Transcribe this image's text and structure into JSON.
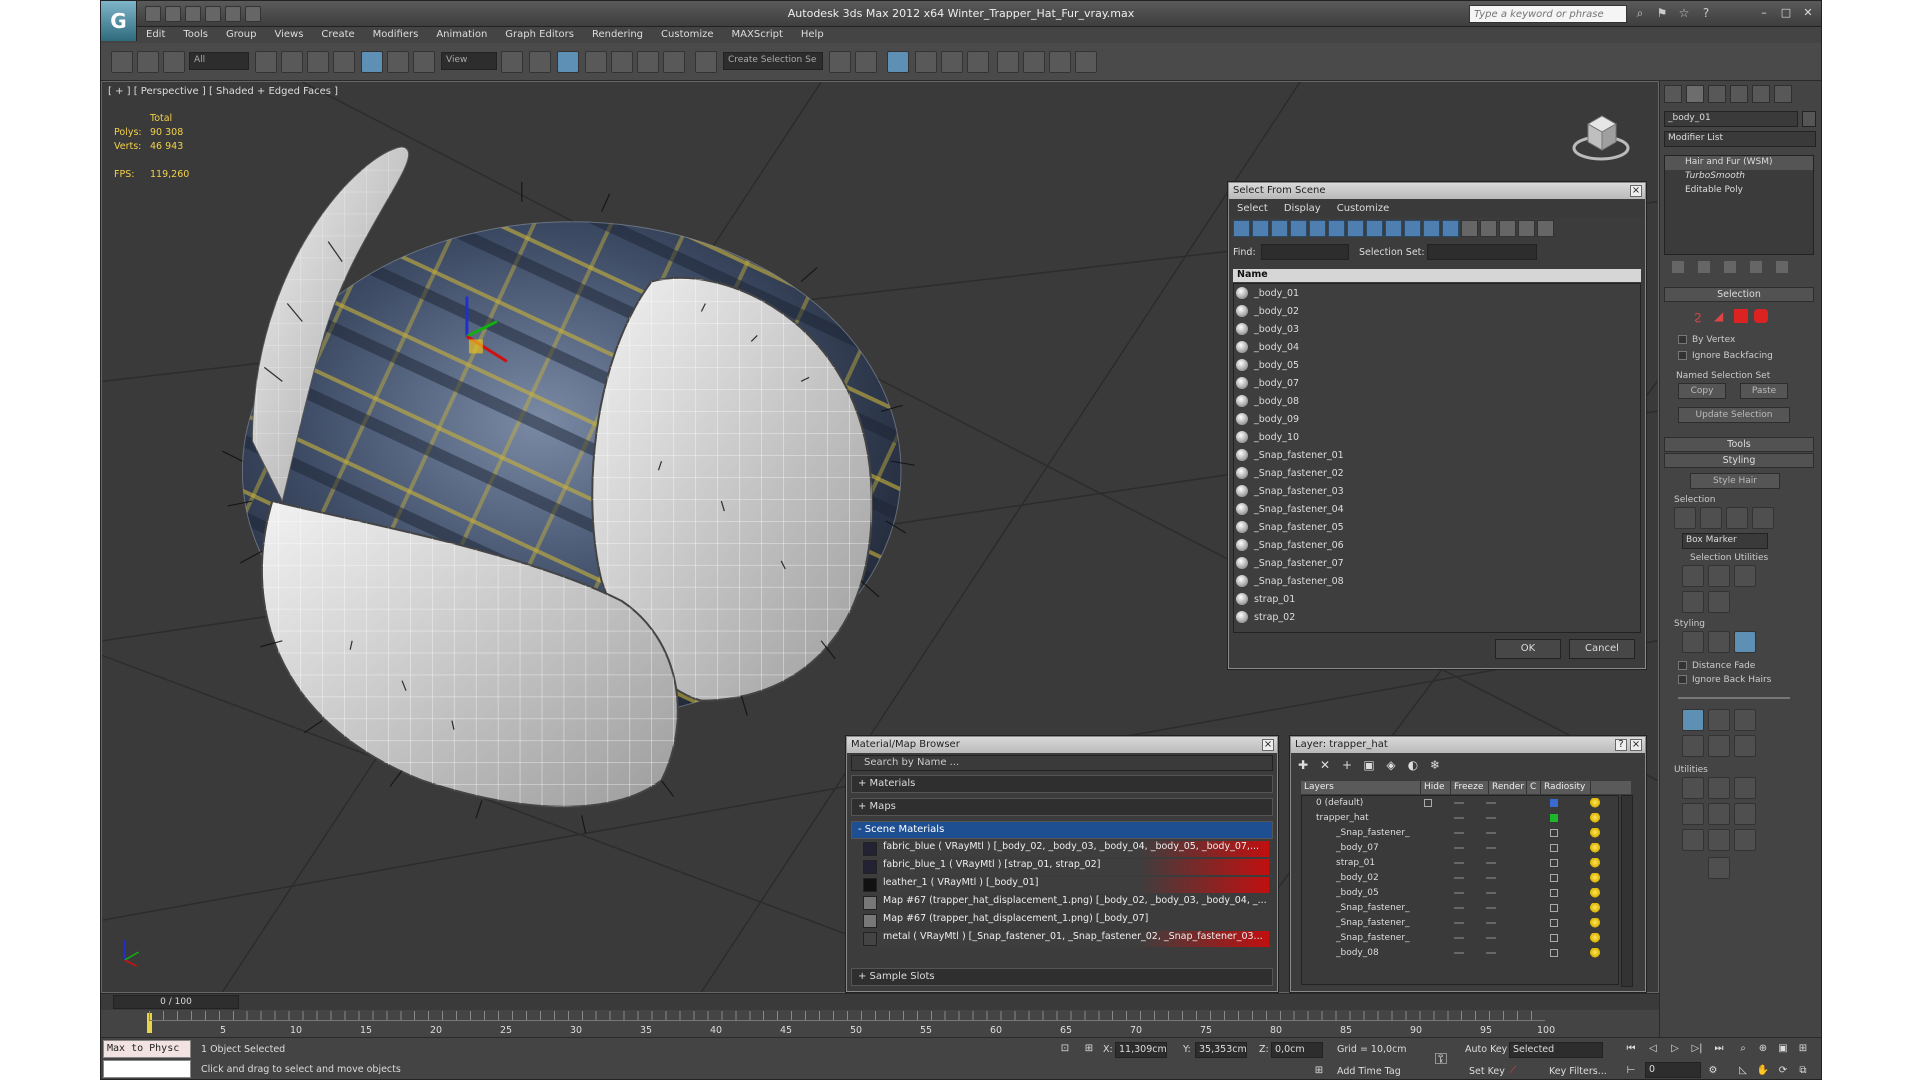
{
  "app": {
    "title": "Autodesk 3ds Max  2012 x64     Winter_Trapper_Hat_Fur_vray.max",
    "logo_glyph": "G",
    "search_placeholder": "Type a keyword or phrase",
    "menu": [
      "Edit",
      "Tools",
      "Group",
      "Views",
      "Create",
      "Modifiers",
      "Animation",
      "Graph Editors",
      "Rendering",
      "Customize",
      "MAXScript",
      "Help"
    ]
  },
  "toolbar": {
    "filter_value": "All",
    "refcoord_value": "View",
    "selection_set_placeholder": "Create Selection Se"
  },
  "viewport": {
    "label": "[ + ] [ Perspective ] [ Shaded + Edged Faces ]",
    "stats_header": "Total",
    "polys_label": "Polys:",
    "polys_value": "90 308",
    "verts_label": "Verts:",
    "verts_value": "46 943",
    "fps_label": "FPS:",
    "fps_value": "119,260"
  },
  "select_from_scene": {
    "title": "Select From Scene",
    "menu": [
      "Select",
      "Display",
      "Customize"
    ],
    "find_label": "Find:",
    "selection_set_label": "Selection Set:",
    "column_name": "Name",
    "items": [
      "_body_01",
      "_body_02",
      "_body_03",
      "_body_04",
      "_body_05",
      "_body_07",
      "_body_08",
      "_body_09",
      "_body_10",
      "_Snap_fastener_01",
      "_Snap_fastener_02",
      "_Snap_fastener_03",
      "_Snap_fastener_04",
      "_Snap_fastener_05",
      "_Snap_fastener_06",
      "_Snap_fastener_07",
      "_Snap_fastener_08",
      "strap_01",
      "strap_02"
    ],
    "ok_label": "OK",
    "cancel_label": "Cancel"
  },
  "material_browser": {
    "title": "Material/Map Browser",
    "search_placeholder": "Search by Name ...",
    "sec_materials": "+ Materials",
    "sec_maps": "+ Maps",
    "sec_scene": "- Scene Materials",
    "sec_sample": "+ Sample Slots",
    "materials": [
      "fabric_blue  ( VRayMtl )  [_body_02, _body_03, _body_04, _body_05, _body_07,...",
      "fabric_blue_1  ( VRayMtl )  [strap_01, strap_02]",
      "leather_1  ( VRayMtl )  [_body_01]",
      "Map #67 (trapper_hat_displacement_1.png) [_body_02, _body_03, _body_04, _...",
      "Map #67 (trapper_hat_displacement_1.png) [_body_07]",
      "metal  ( VRayMtl )  [_Snap_fastener_01, _Snap_fastener_02, _Snap_fastener_03..."
    ]
  },
  "layer_manager": {
    "title": "Layer: trapper_hat",
    "columns": [
      "Layers",
      "Hide",
      "Freeze",
      "Render",
      "C",
      "Radiosity"
    ],
    "rows": [
      "0 (default)",
      "trapper_hat",
      "_Snap_fastener_",
      "_body_07",
      "strap_01",
      "_body_02",
      "_body_05",
      "_Snap_fastener_",
      "_Snap_fastener_",
      "_Snap_fastener_",
      "_body_08"
    ]
  },
  "command_panel": {
    "object_name": "_body_01",
    "modifier_list": "Modifier List",
    "stack": [
      "Hair and Fur (WSM)",
      "TurboSmooth",
      "Editable Poly"
    ],
    "selection_rollout": "Selection",
    "by_vertex": "By Vertex",
    "ignore_backfacing": "Ignore Backfacing",
    "named_selection_set": "Named Selection Set",
    "copy": "Copy",
    "paste": "Paste",
    "update_selection": "Update Selection",
    "tools_rollout": "Tools",
    "styling_rollout": "Styling",
    "style_hair": "Style Hair",
    "selection_sub": "Selection",
    "box_marker": "Box Marker",
    "selection_utilities": "Selection Utilities",
    "styling_sub": "Styling",
    "distance_fade": "Distance Fade",
    "ignore_back_hairs": "Ignore Back Hairs",
    "utilities_sub": "Utilities"
  },
  "timeline": {
    "frame": "0 / 100",
    "ticks": [
      "5",
      "10",
      "15",
      "20",
      "25",
      "30",
      "35",
      "40",
      "45",
      "50",
      "55",
      "60",
      "65",
      "70",
      "75",
      "80",
      "85",
      "90",
      "95",
      "100"
    ]
  },
  "status": {
    "maxscript_1": "Max to Physc",
    "maxscript_2": "",
    "selected": "1 Object Selected",
    "prompt": "Click and drag to select and move objects",
    "x_label": "X:",
    "x_value": "11,309cm",
    "y_label": "Y:",
    "y_value": "35,353cm",
    "z_label": "Z:",
    "z_value": "0,0cm",
    "grid": "Grid = 10,0cm",
    "add_time_tag": "Add Time Tag",
    "auto_key": "Auto Key",
    "set_key": "Set Key",
    "key_dropdown": "Selected",
    "key_filters": "Key Filters...",
    "frame_field": "0"
  },
  "colors": {
    "accent": "#1f4f93",
    "stats": "#f3d14a",
    "highlight_red": "#c01010"
  }
}
